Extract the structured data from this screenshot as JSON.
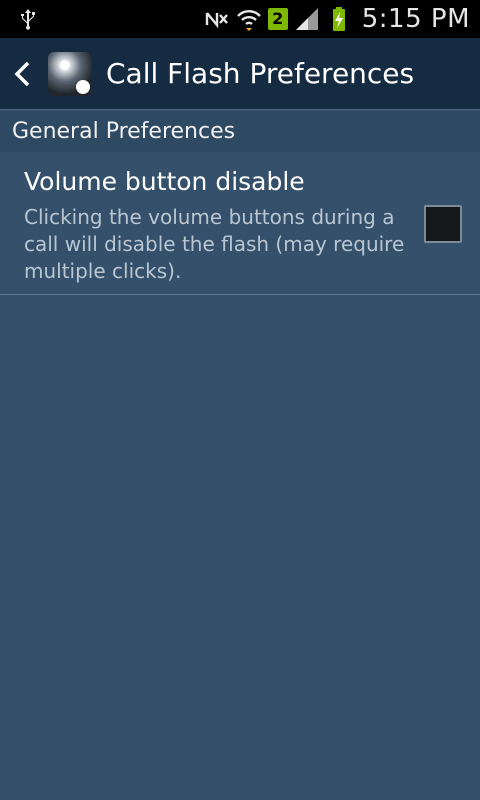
{
  "status_bar": {
    "time": "5:15 PM",
    "sim_badge": "2",
    "icons": [
      "usb-icon",
      "nfc-muted-icon",
      "wifi-icon",
      "signal-icon",
      "battery-charging-icon"
    ],
    "badge_color": "#7fb800"
  },
  "action_bar": {
    "title": "Call Flash Preferences",
    "background": "#152b41"
  },
  "section": {
    "header": "General Preferences"
  },
  "preference": {
    "title": "Volume button disable",
    "summary": "Clicking the volume buttons during a call will disable the flash (may require multiple clicks).",
    "checked": false
  },
  "colors": {
    "page_background": "#34506a",
    "section_background": "#2e4a63"
  }
}
